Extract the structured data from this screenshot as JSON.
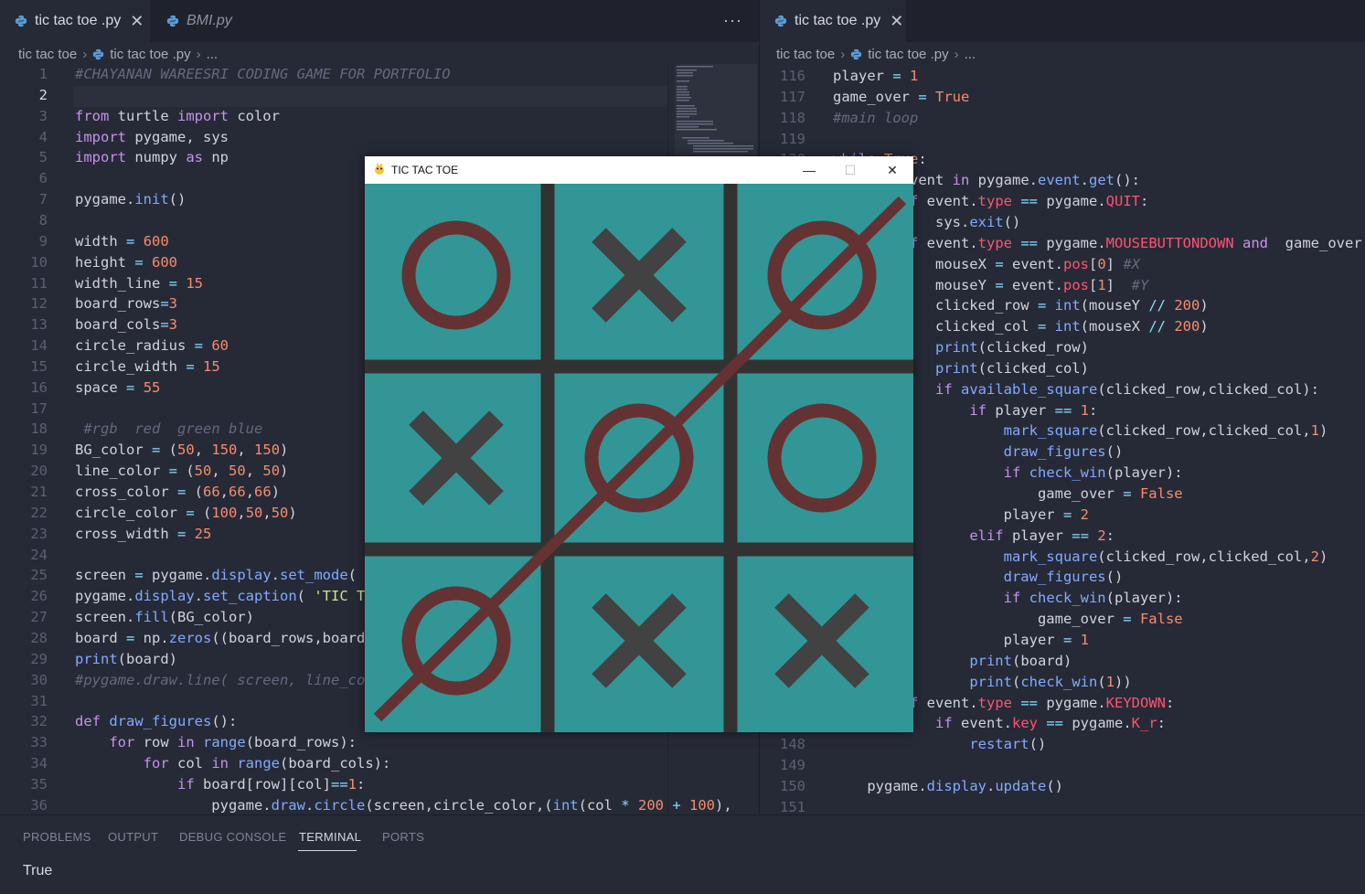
{
  "left": {
    "tabs": [
      {
        "label": "tic tac toe .py",
        "active": true
      },
      {
        "label": "BMI.py",
        "active": false
      }
    ],
    "more": "···",
    "breadcrumb": [
      "tic tac toe",
      "tic tac toe .py",
      "..."
    ],
    "current_line": 2
  },
  "right": {
    "tabs": [
      {
        "label": "tic tac toe .py",
        "active": true
      }
    ],
    "breadcrumb": [
      "tic tac toe",
      "tic tac toe .py",
      "..."
    ]
  },
  "game": {
    "title": "TIC TAC TOE",
    "board": [
      [
        "O",
        "X",
        "O"
      ],
      [
        "X",
        "O",
        "O"
      ],
      [
        "O",
        "X",
        "X"
      ]
    ],
    "bg_color": "#329696",
    "line_color": "#323232",
    "cross_color": "#424242",
    "circle_color": "#643232",
    "win_line": "diagonal bottom-left to top-right"
  },
  "panel": {
    "tabs": [
      "PROBLEMS",
      "OUTPUT",
      "DEBUG CONSOLE",
      "TERMINAL",
      "PORTS"
    ],
    "active_tab": "TERMINAL",
    "terminal_output": "True"
  }
}
